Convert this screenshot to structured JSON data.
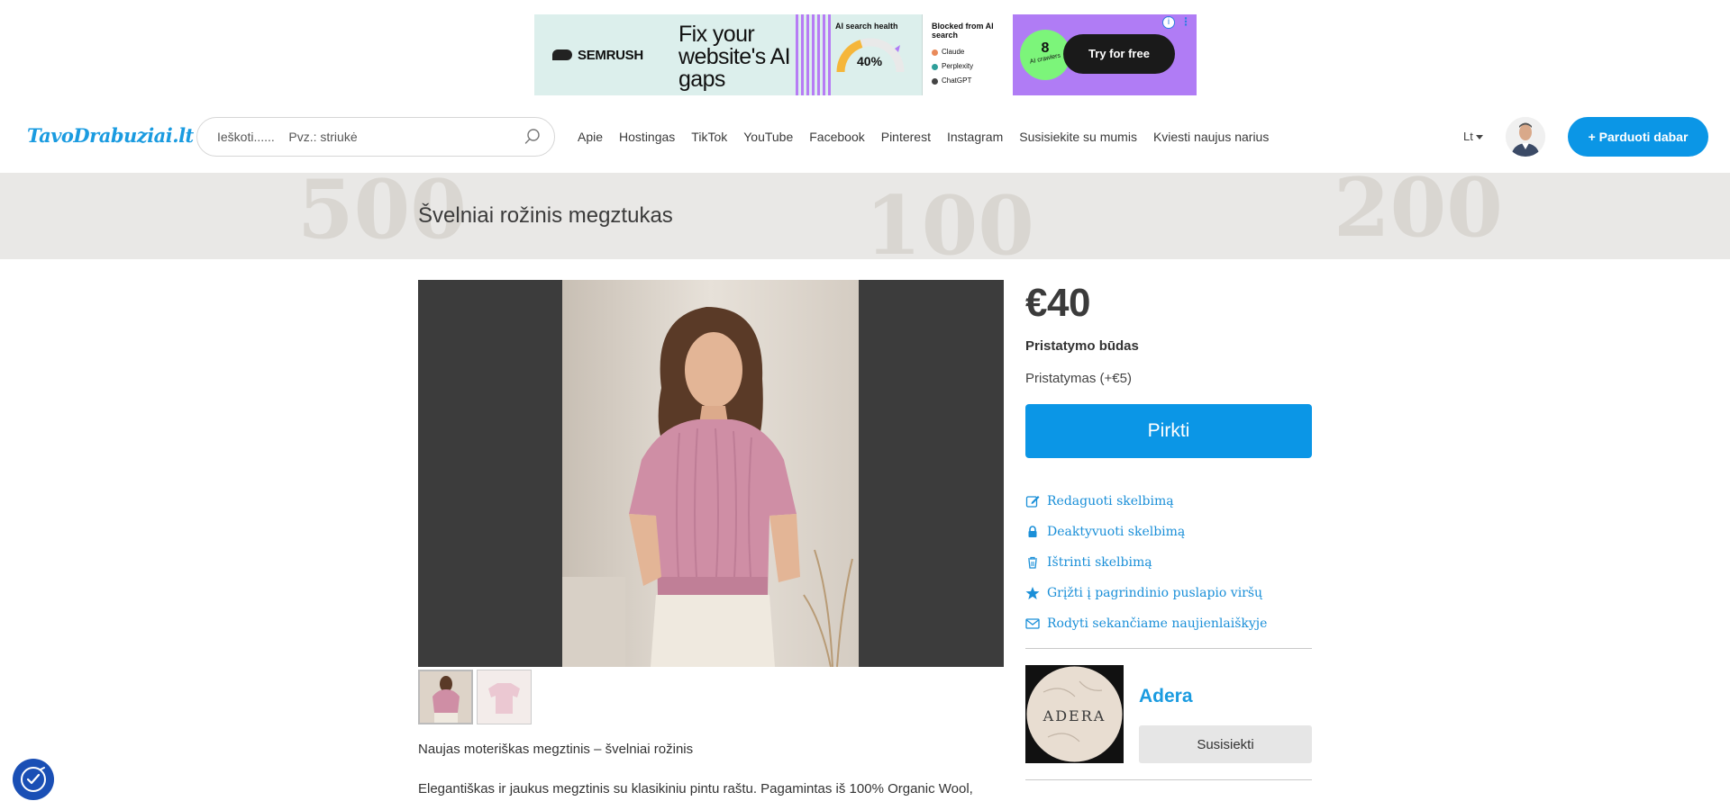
{
  "ad": {
    "brand": "SEMRUSH",
    "headline": "Fix your website's AI gaps",
    "gauge_title": "AI search health",
    "gauge_value": "40%",
    "gauge_fraction": 0.4,
    "blocked_title": "Blocked from AI search",
    "blocked_items": [
      "Claude",
      "Perplexity",
      "ChatGPT"
    ],
    "badge_number": "8",
    "badge_label": "AI crawlers",
    "cta": "Try for free",
    "info_icon": "info-icon",
    "colors": {
      "bg": "#dcefec",
      "purple": "#b07cf5",
      "green": "#7cf57a",
      "gauge": "#f5b63a"
    }
  },
  "header": {
    "logo": "TavoDrabuziai.lt",
    "search_placeholder": "Ieškoti......    Pvz.: striukė",
    "nav": [
      "Apie",
      "Hostingas",
      "TikTok",
      "YouTube",
      "Facebook",
      "Pinterest",
      "Instagram",
      "Susisiekite su mumis",
      "Kviesti naujus narius"
    ],
    "language": "Lt",
    "sell_button": "+ Parduoti dabar",
    "accent": "#0b96e6"
  },
  "listing": {
    "title": "Švelniai rožinis megztukas",
    "price": "€40",
    "shipping_label": "Pristatymo būdas",
    "shipping_option": "Pristatymas (+€5)",
    "buy_button": "Pirkti",
    "actions": [
      {
        "label": "Redaguoti skelbimą",
        "icon": "edit-icon"
      },
      {
        "label": "Deaktyvuoti skelbimą",
        "icon": "lock-icon"
      },
      {
        "label": "Ištrinti skelbimą",
        "icon": "trash-icon"
      },
      {
        "label": "Grįžti į pagrindinio puslapio viršų",
        "icon": "star-icon"
      },
      {
        "label": "Rodyti sekančiame naujienlaiškyje",
        "icon": "envelope-icon"
      }
    ],
    "description_heading": "Naujas moteriškas megztinis – švelniai rožinis",
    "description_body": "Elegantiškas ir jaukus megztinis su klasikiniu pintu raštu. Pagamintas iš 100% Organic Wool,"
  },
  "seller": {
    "name": "Adera",
    "logo_text": "ADERA",
    "contact_button": "Susisiekti"
  }
}
